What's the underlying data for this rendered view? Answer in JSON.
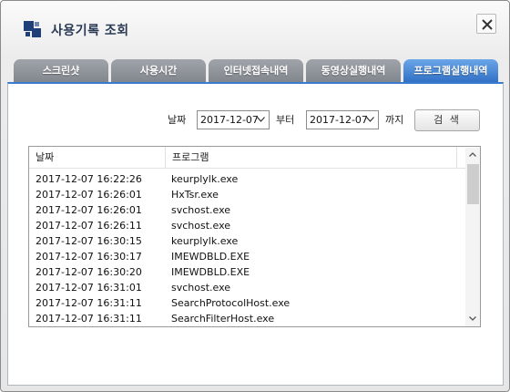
{
  "window": {
    "title": "사용기록 조회"
  },
  "icons": {
    "app": "app-logo-icon",
    "close": "close-icon",
    "dropdown": "chevron-down-icon",
    "scroll_up": "arrow-up-icon",
    "scroll_down": "arrow-down-icon"
  },
  "colors": {
    "active_tab": "#2f6fc4",
    "inactive_tab": "#8a8f96",
    "accent_border": "#3a7bd0",
    "title_text": "#2a3a55"
  },
  "tabs": [
    {
      "label": "스크린샷",
      "active": false
    },
    {
      "label": "사용시간",
      "active": false
    },
    {
      "label": "인터넷접속내역",
      "active": false
    },
    {
      "label": "동영상실행내역",
      "active": false
    },
    {
      "label": "프로그램실행내역",
      "active": true
    }
  ],
  "filter": {
    "date_label": "날짜",
    "from_value": "2017-12-07",
    "from_label": "부터",
    "to_value": "2017-12-07",
    "to_label": "까지",
    "search_button": "검 색"
  },
  "table": {
    "columns": [
      "날짜",
      "프로그램"
    ],
    "rows": [
      {
        "date": "2017-12-07 16:22:26",
        "program": "keurplylk.exe"
      },
      {
        "date": "2017-12-07 16:26:01",
        "program": "HxTsr.exe"
      },
      {
        "date": "2017-12-07 16:26:01",
        "program": "svchost.exe"
      },
      {
        "date": "2017-12-07 16:26:11",
        "program": "svchost.exe"
      },
      {
        "date": "2017-12-07 16:30:15",
        "program": "keurplylk.exe"
      },
      {
        "date": "2017-12-07 16:30:17",
        "program": "IMEWDBLD.EXE"
      },
      {
        "date": "2017-12-07 16:30:20",
        "program": "IMEWDBLD.EXE"
      },
      {
        "date": "2017-12-07 16:31:01",
        "program": "svchost.exe"
      },
      {
        "date": "2017-12-07 16:31:11",
        "program": "SearchProtocolHost.exe"
      },
      {
        "date": "2017-12-07 16:31:11",
        "program": "SearchFilterHost.exe"
      }
    ]
  }
}
